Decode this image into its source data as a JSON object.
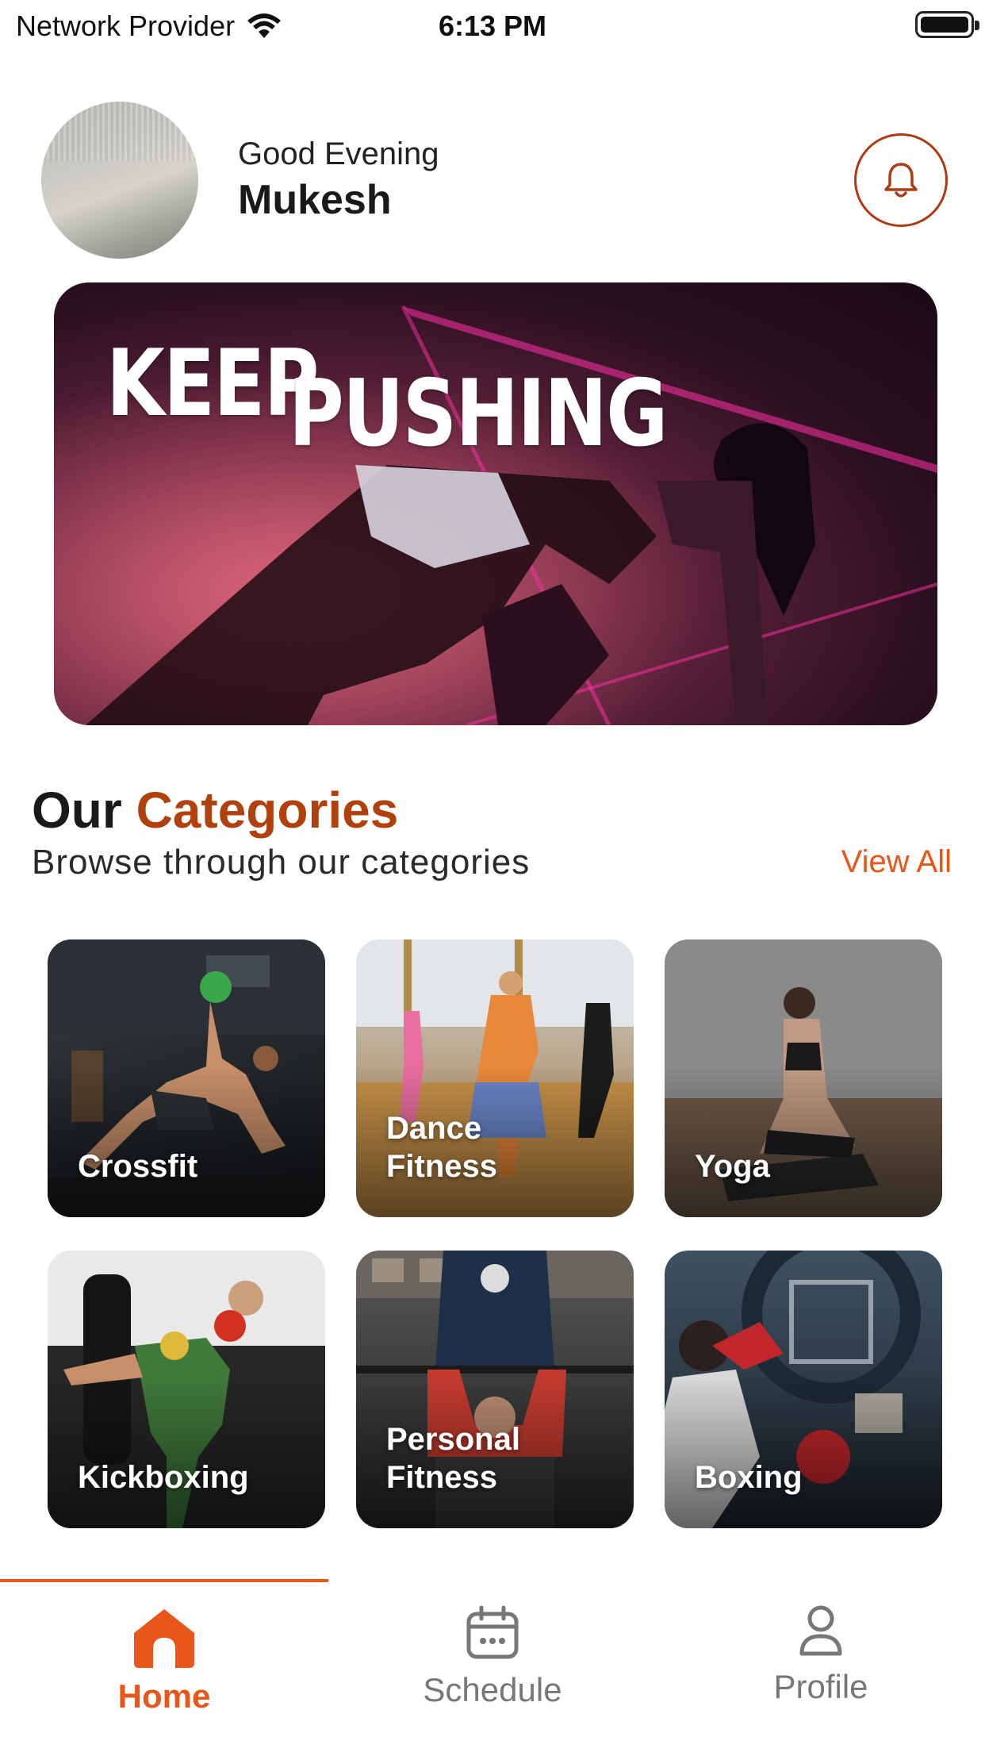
{
  "status_bar": {
    "carrier": "Network Provider",
    "time": "6:13 PM"
  },
  "header": {
    "greeting": "Good Evening",
    "name": "Mukesh"
  },
  "banner": {
    "line1": "KEEP",
    "line2": "PUSHING"
  },
  "categories": {
    "title_part1": "Our",
    "title_part2": "Categories",
    "subtitle": "Browse through our categories",
    "view_all": "View All",
    "items": [
      {
        "line1": "Crossfit",
        "line2": ""
      },
      {
        "line1": "Dance",
        "line2": "Fitness"
      },
      {
        "line1": "Yoga",
        "line2": ""
      },
      {
        "line1": "Kickboxing",
        "line2": ""
      },
      {
        "line1": "Personal",
        "line2": "Fitness"
      },
      {
        "line1": "Boxing",
        "line2": ""
      }
    ]
  },
  "nav": {
    "items": [
      {
        "label": "Home",
        "icon": "home-icon",
        "active": true
      },
      {
        "label": "Schedule",
        "icon": "calendar-icon",
        "active": false
      },
      {
        "label": "Profile",
        "icon": "user-icon",
        "active": false
      }
    ]
  },
  "colors": {
    "accent": "#e8561a",
    "accent_dark": "#b0410d",
    "inactive": "#777777"
  }
}
